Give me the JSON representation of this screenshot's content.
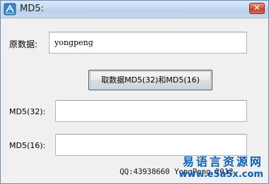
{
  "window": {
    "title": "MD5:",
    "close_glyph": "✕",
    "icon": "app-icon"
  },
  "form": {
    "source_label": "原数据:",
    "source_value": "yongpeng",
    "action_button_label": "取数据MD5(32)和MD5(16)",
    "md5_32_label": "MD5(32):",
    "md5_32_value": "",
    "md5_16_label": "MD5(16):",
    "md5_16_value": ""
  },
  "footer": {
    "qq_text": "QQ:43938660 YongPeng 2012"
  },
  "watermark": {
    "site_name": "易语言资源网",
    "url": "www.e5a5x.com"
  },
  "colors": {
    "titlebar": "#c8daf0",
    "close_button": "#c94a34",
    "watermark": "#0b5fb5"
  }
}
